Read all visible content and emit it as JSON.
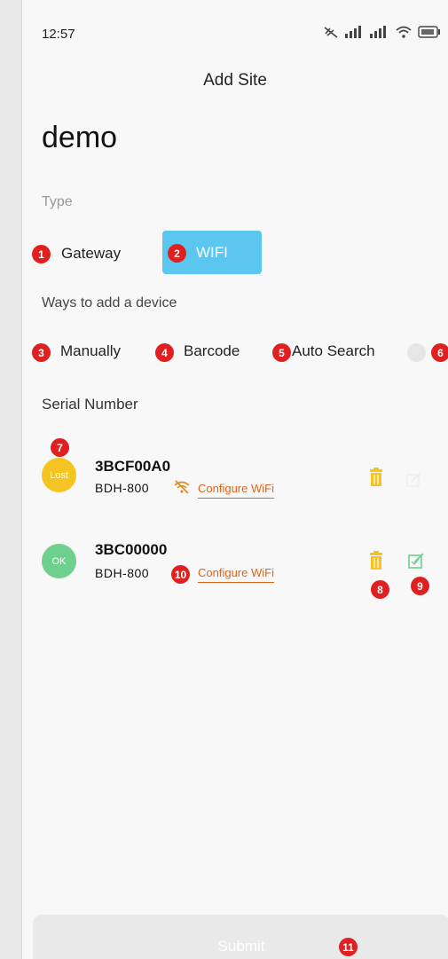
{
  "status_bar": {
    "time": "12:57"
  },
  "header": {
    "title": "Add Site"
  },
  "site": {
    "name": "demo"
  },
  "type_section": {
    "label": "Type",
    "options": [
      "Gateway",
      "WIFI"
    ],
    "selected": "WIFI"
  },
  "ways_section": {
    "label": "Ways to add a device",
    "options": [
      "Manually",
      "Barcode",
      "Auto Search"
    ]
  },
  "serial_section": {
    "label": "Serial Number"
  },
  "devices": [
    {
      "status": "Lost",
      "status_color": "#f5c422",
      "serial": "3BCF00A0",
      "model": "BDH-800",
      "configure_label": "Configure WiFi"
    },
    {
      "status": "OK",
      "status_color": "#6fcf8c",
      "serial": "3BC00000",
      "model": "BDH-800",
      "configure_label": "Configure WiFi"
    }
  ],
  "annotations": [
    "1",
    "2",
    "3",
    "4",
    "5",
    "6",
    "7",
    "8",
    "9",
    "10",
    "11"
  ],
  "footer": {
    "submit_label": "Submit"
  },
  "colors": {
    "accent": "#5bc6f0",
    "badge": "#e02020",
    "link": "#e0641a",
    "trash": "#f5c422",
    "edit": "#6fcf8c"
  }
}
